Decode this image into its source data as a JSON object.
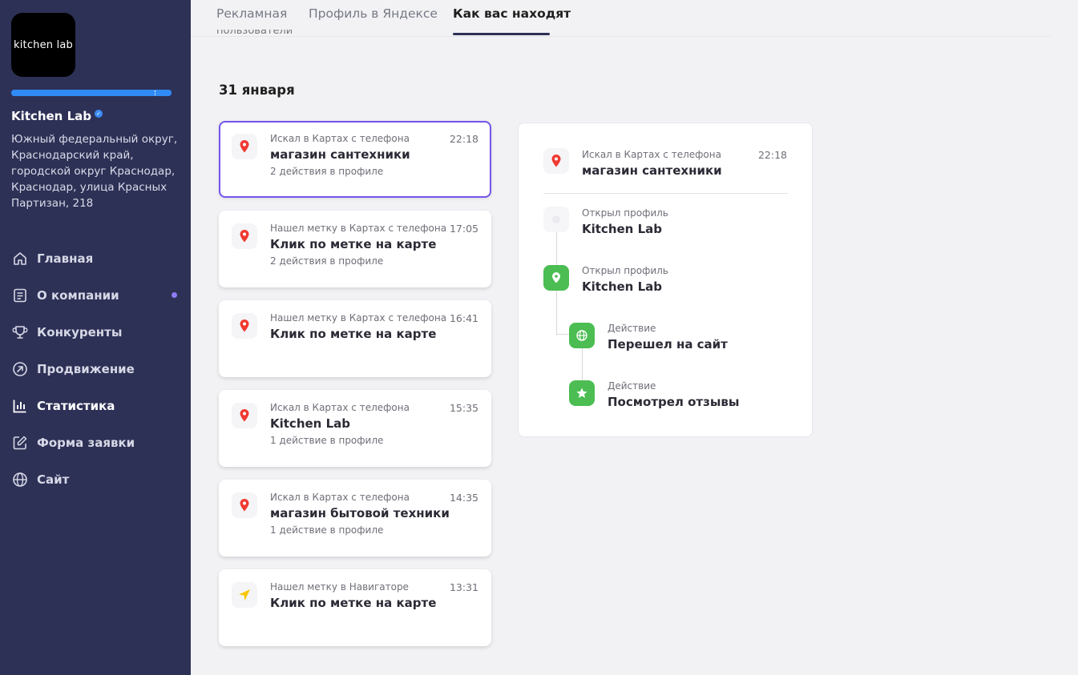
{
  "sidebar": {
    "logo_text": "kitchen lab",
    "company_name": "Kitchen Lab",
    "verified_icon": "check-badge-icon",
    "address": "Южный федеральный округ, Краснодарский край, городской округ Краснодар, Краснодар, улица Красных Партизан, 218",
    "nav": [
      {
        "label": "Главная",
        "icon": "home-icon"
      },
      {
        "label": "О компании",
        "icon": "document-icon",
        "dot": true
      },
      {
        "label": "Конкуренты",
        "icon": "trophy-icon"
      },
      {
        "label": "Продвижение",
        "icon": "arrow-circle-icon"
      },
      {
        "label": "Статистика",
        "icon": "bar-chart-icon",
        "active": true
      },
      {
        "label": "Форма заявки",
        "icon": "edit-form-icon"
      },
      {
        "label": "Сайт",
        "icon": "globe-icon"
      }
    ]
  },
  "tabs": [
    {
      "label": "Рекламная"
    },
    {
      "label": "Профиль в Яндексе"
    },
    {
      "label": "Как вас находят",
      "active": true
    }
  ],
  "cut_text": "пользователи",
  "date_heading": "31 января",
  "events": [
    {
      "source": "Искал в Картах с телефона",
      "time": "22:18",
      "title": "магазин сантехники",
      "sub": "2 действия в профиле",
      "icon": "map-pin-icon",
      "selected": true
    },
    {
      "source": "Нашел метку в Картах с телефона",
      "time": "17:05",
      "title": "Клик по метке на карте",
      "sub": "2 действия в профиле",
      "icon": "map-pin-icon"
    },
    {
      "source": "Нашел метку в Картах с телефона",
      "time": "16:41",
      "title": "Клик по метке на карте",
      "sub": "",
      "icon": "map-pin-icon"
    },
    {
      "source": "Искал в Картах с телефона",
      "time": "15:35",
      "title": "Kitchen Lab",
      "sub": "1 действие в профиле",
      "icon": "map-pin-icon"
    },
    {
      "source": "Искал в Картах с телефона",
      "time": "14:35",
      "title": "магазин бытовой техники",
      "sub": "1 действие в профиле",
      "icon": "map-pin-icon"
    },
    {
      "source": "Нашел метку в Навигаторе",
      "time": "13:31",
      "title": "Клик по метке на карте",
      "sub": "",
      "icon": "navigator-arrow-icon"
    }
  ],
  "detail": {
    "header": {
      "source": "Искал в Картах с телефона",
      "time": "22:18",
      "title": "магазин сантехники"
    },
    "steps": [
      {
        "label": "Открыл профиль",
        "title": "Kitchen Lab",
        "icon": "profile-faint-icon"
      },
      {
        "label": "Открыл профиль",
        "title": "Kitchen Lab",
        "icon": "map-pin-green-icon"
      },
      {
        "label": "Действие",
        "title": "Перешел на сайт",
        "icon": "globe-icon"
      },
      {
        "label": "Действие",
        "title": "Посмотрел отзывы",
        "icon": "star-icon"
      }
    ]
  },
  "colors": {
    "sidebar_bg": "#2e3156",
    "accent_purple": "#7455e8",
    "green": "#4bbd52",
    "pin_red": "#f03a32",
    "nav_yellow": "#f7c600"
  }
}
